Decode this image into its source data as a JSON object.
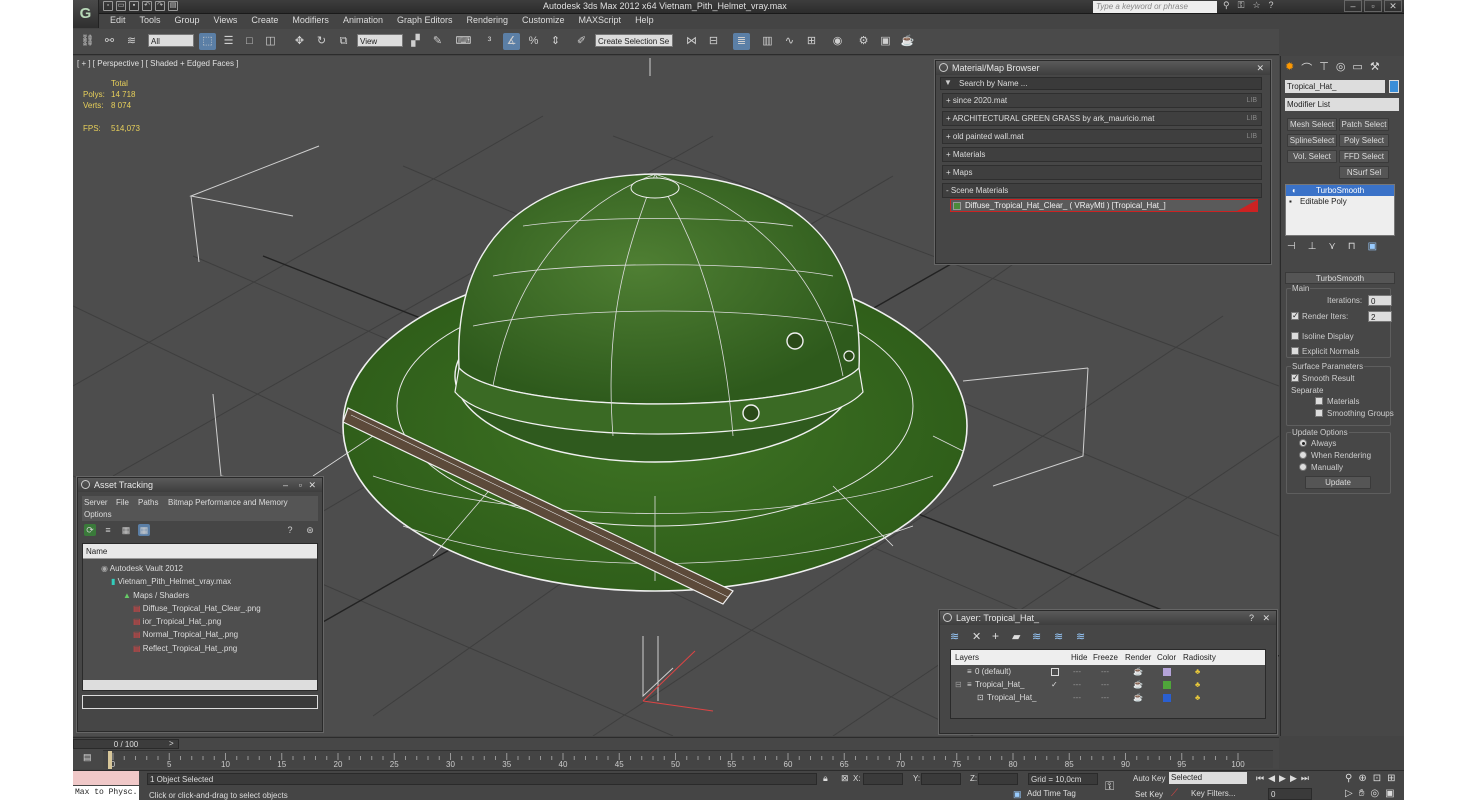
{
  "app": {
    "title": "Autodesk 3ds Max  2012 x64     Vietnam_Pith_Helmet_vray.max",
    "search_placeholder": "Type a keyword or phrase"
  },
  "menu": [
    "Edit",
    "Tools",
    "Group",
    "Views",
    "Create",
    "Modifiers",
    "Animation",
    "Graph Editors",
    "Rendering",
    "Customize",
    "MAXScript",
    "Help"
  ],
  "toolbar": {
    "filter": "All",
    "ref_coord": "View",
    "selection_set": "Create Selection Se"
  },
  "viewport": {
    "label": "[ + ] [ Perspective ] [ Shaded + Edged Faces ]",
    "stats": {
      "total": "Total",
      "polys_label": "Polys:",
      "polys": "14 718",
      "verts_label": "Verts:",
      "verts": "8 074",
      "fps_label": "FPS:",
      "fps": "514,073"
    }
  },
  "material_browser": {
    "title": "Material/Map Browser",
    "search": "Search by Name ...",
    "lib": "LIB",
    "items": [
      {
        "label": "+ since 2020.mat",
        "lib": true
      },
      {
        "label": "+ ARCHITECTURAL GREEN GRASS by ark_mauricio.mat",
        "lib": true
      },
      {
        "label": "+ old painted wall.mat",
        "lib": true
      },
      {
        "label": "+ Materials",
        "lib": false
      },
      {
        "label": "+ Maps",
        "lib": false
      },
      {
        "label": "- Scene Materials",
        "lib": false
      }
    ],
    "scene_material": "Diffuse_Tropical_Hat_Clear_  ( VRayMtl )  [Tropical_Hat_]"
  },
  "asset_tracking": {
    "title": "Asset Tracking",
    "menu": [
      "Server",
      "File",
      "Paths",
      "Bitmap Performance and Memory"
    ],
    "menu2": "Options",
    "column": "Name",
    "tree": [
      "Autodesk Vault 2012",
      "Vietnam_Pith_Helmet_vray.max",
      "Maps / Shaders",
      "Diffuse_Tropical_Hat_Clear_.png",
      "ior_Tropical_Hat_.png",
      "Normal_Tropical_Hat_.png",
      "Reflect_Tropical_Hat_.png"
    ]
  },
  "layer": {
    "title": "Layer: Tropical_Hat_",
    "columns": [
      "Layers",
      "Hide",
      "Freeze",
      "Render",
      "Color",
      "Radiosity"
    ],
    "rows": [
      {
        "name": "0 (default)",
        "color": "#b4a3d8"
      },
      {
        "name": "Tropical_Hat_",
        "color": "#4fa63a"
      },
      {
        "name": "Tropical_Hat_",
        "color": "#2a5fd0"
      }
    ]
  },
  "command_panel": {
    "object_name": "Tropical_Hat_",
    "modifier_list": "Modifier List",
    "buttons": [
      "Mesh Select",
      "Patch Select",
      "SplineSelect",
      "Poly Select",
      "Vol. Select",
      "FFD Select",
      "NSurf Sel"
    ],
    "stack": [
      "TurboSmooth",
      "Editable Poly"
    ],
    "rollout": "TurboSmooth",
    "main": "Main",
    "iterations_label": "Iterations:",
    "iterations": "0",
    "render_iters_label": "Render Iters:",
    "render_iters": "2",
    "isoline": "Isoline Display",
    "explicit": "Explicit Normals",
    "surface": "Surface Parameters",
    "smooth_result": "Smooth Result",
    "separate": "Separate",
    "materials": "Materials",
    "smoothing": "Smoothing Groups",
    "update_options": "Update Options",
    "always": "Always",
    "when_rendering": "When Rendering",
    "manually": "Manually",
    "update": "Update"
  },
  "timeline": {
    "frame": "0 / 100",
    "ticks": [
      "0",
      "5",
      "10",
      "15",
      "20",
      "25",
      "30",
      "35",
      "40",
      "45",
      "50",
      "55",
      "60",
      "65",
      "70",
      "75",
      "80",
      "85",
      "90",
      "95",
      "100"
    ]
  },
  "status": {
    "script": "Max to Physc.",
    "selected": "1 Object Selected",
    "prompt": "Click or click-and-drag to select objects",
    "x": "X:",
    "y": "Y:",
    "z": "Z:",
    "grid": "Grid = 10,0cm",
    "add_time_tag": "Add Time Tag",
    "auto_key": "Auto Key",
    "set_key": "Set Key",
    "key_mode": "Selected",
    "key_filters": "Key Filters...",
    "frame_field": "0"
  }
}
